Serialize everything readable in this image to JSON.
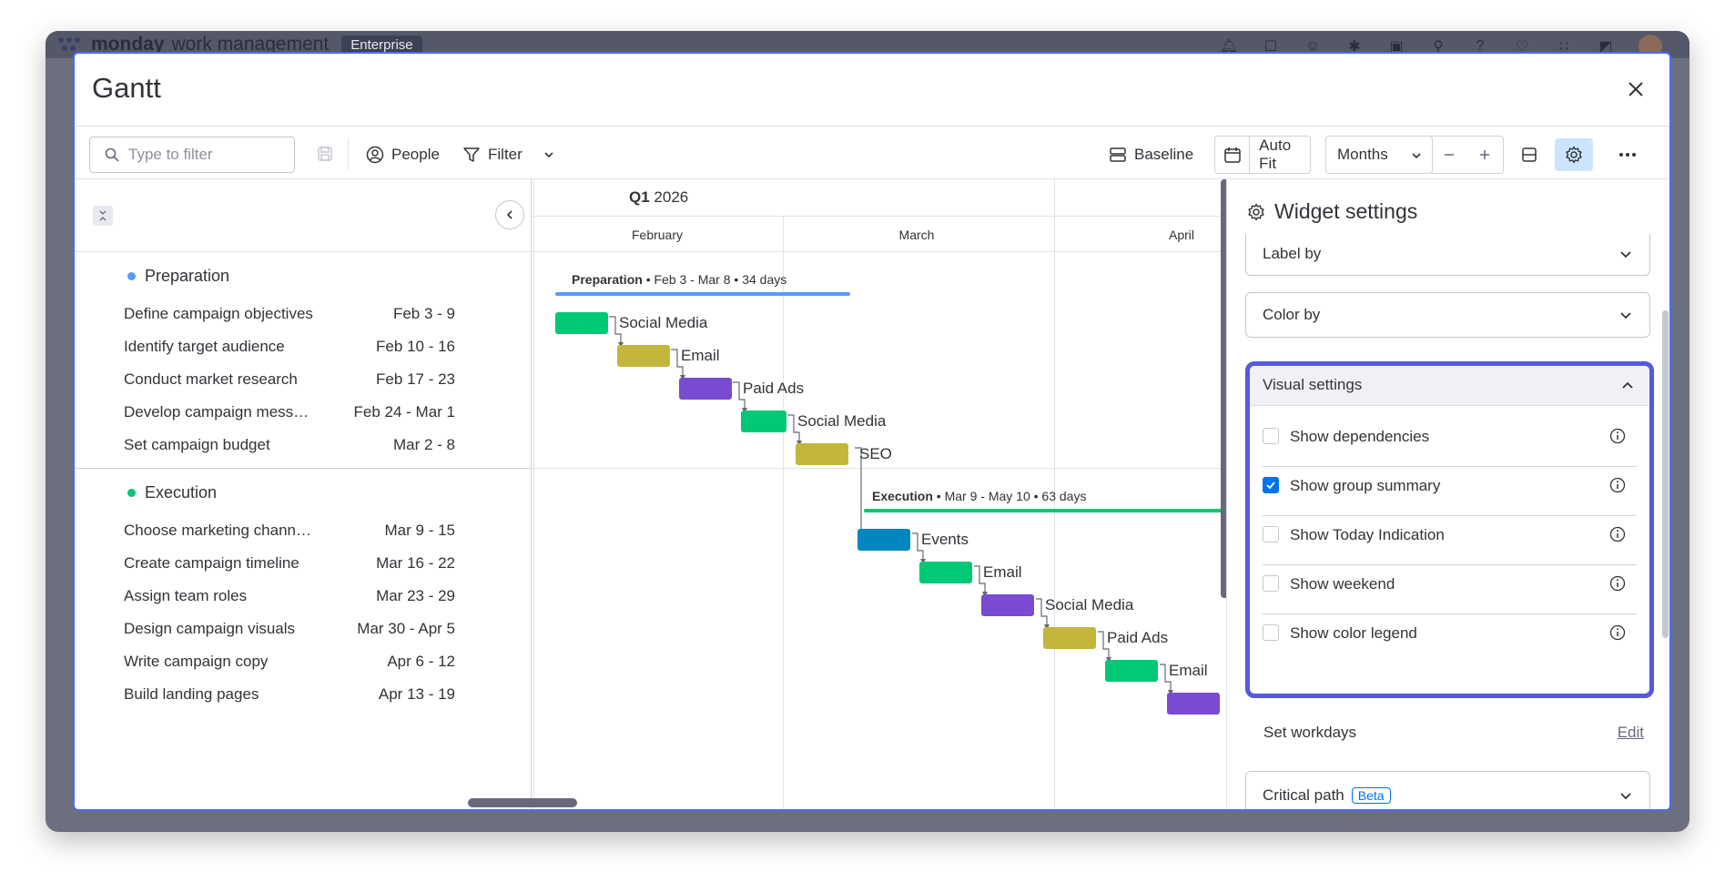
{
  "app": {
    "brand": "monday",
    "brand_sub": "work management",
    "plan": "Enterprise"
  },
  "modal": {
    "title": "Gantt"
  },
  "toolbar": {
    "search_placeholder": "Type to filter",
    "people_label": "People",
    "filter_label": "Filter",
    "baseline_label": "Baseline",
    "autofit_label": "Auto Fit",
    "timescale_value": "Months"
  },
  "timeline": {
    "quarter_bold": "Q1",
    "quarter_year": "2026",
    "months": [
      "February",
      "March",
      "April"
    ]
  },
  "groups": [
    {
      "name": "Preparation",
      "color": "#579bfc",
      "summary": {
        "name": "Preparation",
        "details": "• Feb 3 - Mar 8 • 34 days"
      },
      "tasks": [
        {
          "name": "Define campaign objectives",
          "date": "Feb 3 - 9",
          "label": "Social Media",
          "color": "#00c875"
        },
        {
          "name": "Identify target audience",
          "date": "Feb 10 - 16",
          "label": "Email",
          "color": "#c4b53d"
        },
        {
          "name": "Conduct market research",
          "date": "Feb 17 - 23",
          "label": "Paid Ads",
          "color": "#784bd1"
        },
        {
          "name": "Develop campaign messag...",
          "date": "Feb 24 - Mar 1",
          "label": "Social Media",
          "color": "#00c875"
        },
        {
          "name": "Set campaign budget",
          "date": "Mar 2 - 8",
          "label": "SEO",
          "color": "#c4b53d"
        }
      ]
    },
    {
      "name": "Execution",
      "color": "#00c875",
      "summary": {
        "name": "Execution",
        "details": "• Mar 9 - May 10 • 63 days"
      },
      "tasks": [
        {
          "name": "Choose marketing channels",
          "date": "Mar 9 - 15",
          "label": "Events",
          "color": "#0086c0"
        },
        {
          "name": "Create campaign timeline",
          "date": "Mar 16 - 22",
          "label": "Email",
          "color": "#00c875"
        },
        {
          "name": "Assign team roles",
          "date": "Mar 23 - 29",
          "label": "Social Media",
          "color": "#784bd1"
        },
        {
          "name": "Design campaign visuals",
          "date": "Mar 30 - Apr 5",
          "label": "Paid Ads",
          "color": "#c4b53d"
        },
        {
          "name": "Write campaign copy",
          "date": "Apr 6 - 12",
          "label": "Email",
          "color": "#00c875"
        },
        {
          "name": "Build landing pages",
          "date": "Apr 13 - 19",
          "label": "",
          "color": "#784bd1"
        }
      ]
    }
  ],
  "settings": {
    "title": "Widget settings",
    "label_by": "Label by",
    "color_by": "Color by",
    "visual_settings": "Visual settings",
    "options": [
      {
        "label": "Show dependencies",
        "checked": false
      },
      {
        "label": "Show group summary",
        "checked": true
      },
      {
        "label": "Show Today Indication",
        "checked": false
      },
      {
        "label": "Show weekend",
        "checked": false
      },
      {
        "label": "Show color legend",
        "checked": false
      }
    ],
    "workdays_label": "Set workdays",
    "workdays_edit": "Edit",
    "critical_path": "Critical path",
    "beta": "Beta"
  }
}
